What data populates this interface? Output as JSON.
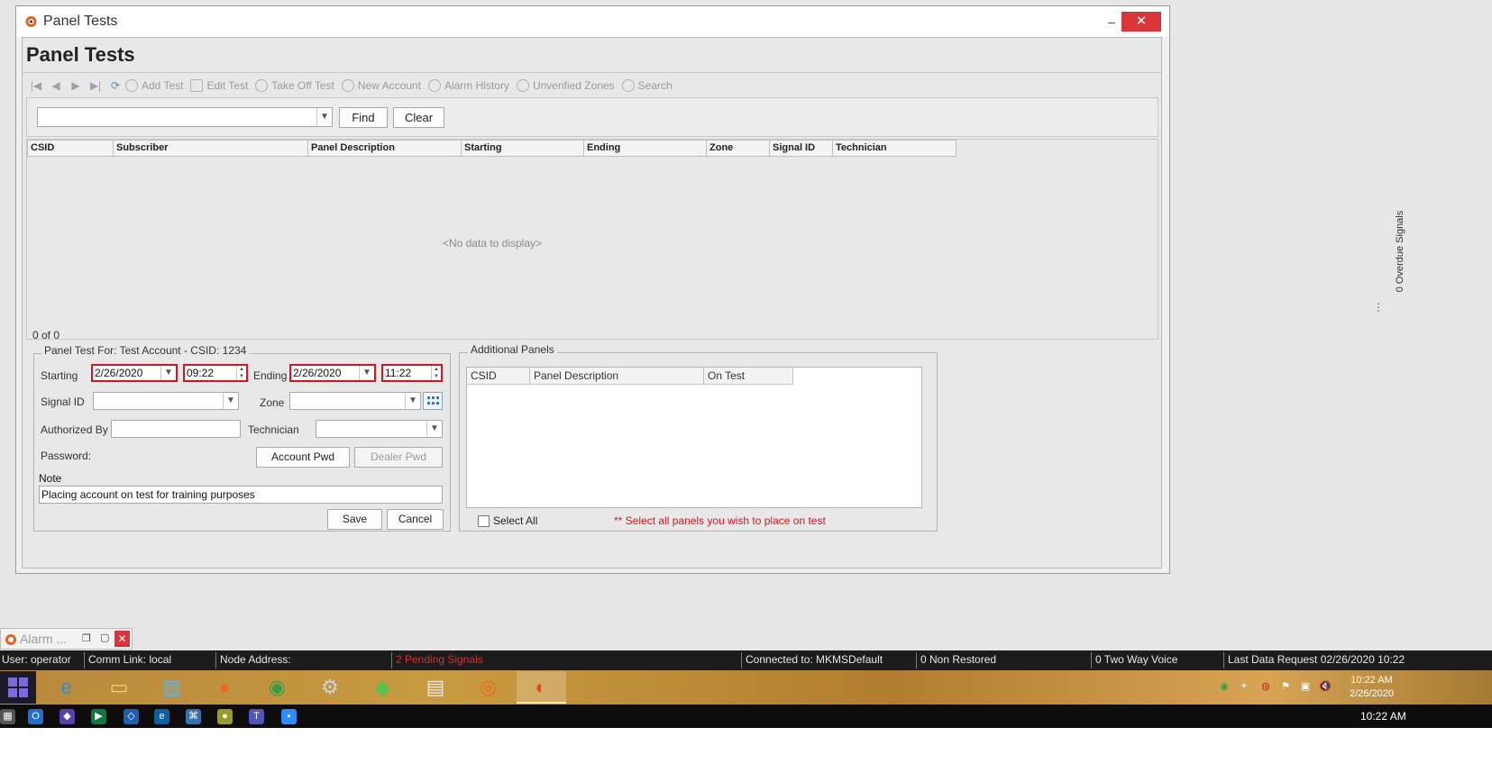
{
  "window": {
    "title": "Panel Tests",
    "minimize": "‒",
    "close": "✕"
  },
  "page": {
    "heading": "Panel Tests"
  },
  "toolbar": {
    "nav": [
      "|◀",
      "◀",
      "▶",
      "▶|"
    ],
    "items": [
      {
        "label": "Add Test",
        "icon": "add-icon"
      },
      {
        "label": "Edit Test",
        "icon": "edit-icon"
      },
      {
        "label": "Take Off Test",
        "icon": "remove-icon"
      },
      {
        "label": "New Account",
        "icon": "users-icon"
      },
      {
        "label": "Alarm History",
        "icon": "history-icon"
      },
      {
        "label": "Unverified Zones",
        "icon": "zones-icon"
      },
      {
        "label": "Search",
        "icon": "search-icon"
      }
    ]
  },
  "search": {
    "value": "",
    "find_label": "Find",
    "clear_label": "Clear"
  },
  "grid": {
    "columns": [
      "CSID",
      "Subscriber",
      "Panel Description",
      "Starting",
      "Ending",
      "Zone",
      "Signal ID",
      "Technician"
    ],
    "empty_text": "<No data to display>",
    "record_count": "0 of 0"
  },
  "panel_test": {
    "legend": "Panel Test For: Test Account - CSID: 1234",
    "starting_label": "Starting",
    "starting_date": "2/26/2020",
    "starting_time": "09:22",
    "ending_label": "Ending",
    "ending_date": "2/26/2020",
    "ending_time": "11:22",
    "signal_id_label": "Signal ID",
    "signal_id_value": "",
    "zone_label": "Zone",
    "zone_value": "",
    "authorized_by_label": "Authorized By",
    "authorized_by_value": "",
    "technician_label": "Technician",
    "technician_value": "",
    "password_label": "Password:",
    "account_pwd_label": "Account Pwd",
    "dealer_pwd_label": "Dealer Pwd",
    "note_label": "Note",
    "note_value": "Placing account on test for training purposes",
    "save_label": "Save",
    "cancel_label": "Cancel"
  },
  "additional_panels": {
    "legend": "Additional Panels",
    "columns": [
      "CSID",
      "Panel Description",
      "On Test"
    ],
    "select_all_label": "Select All",
    "hint": "** Select all panels you wish to place on test"
  },
  "sidebar_right": {
    "overdue_label": "0 Overdue Signals",
    "more": "⋮"
  },
  "mini_alarm": {
    "label": "Alarm ..."
  },
  "status_bar": {
    "user": "User: operator",
    "comm_link": "Comm Link: local",
    "node_address": "Node Address:",
    "pending_signals": "2 Pending Signals",
    "connected": "Connected to: MKMSDefault",
    "non_restored": "0 Non Restored",
    "two_way_voice": "0 Two Way Voice",
    "last_data_request": "Last Data Request 02/26/2020 10:22"
  },
  "taskbar": {
    "apps": [
      {
        "icon": "internet-explorer-icon",
        "glyph": "e",
        "color": "#2a8ee0"
      },
      {
        "icon": "file-explorer-icon",
        "glyph": "▭",
        "color": "#f4d173"
      },
      {
        "icon": "city-app-icon",
        "glyph": "▥",
        "color": "#5fb6e8"
      },
      {
        "icon": "firefox-icon",
        "glyph": "●",
        "color": "#e66b1f"
      },
      {
        "icon": "chrome-icon",
        "glyph": "◉",
        "color": "#3a9b45"
      },
      {
        "icon": "settings-gear-icon",
        "glyph": "⚙",
        "color": "#c8d6e6"
      },
      {
        "icon": "green-gem-icon",
        "glyph": "◆",
        "color": "#57c24d"
      },
      {
        "icon": "archive-icon",
        "glyph": "▤",
        "color": "#e8e8e8"
      },
      {
        "icon": "orange-circle-icon",
        "glyph": "◎",
        "color": "#ef6b1c"
      },
      {
        "icon": "alarm-monitor-icon",
        "glyph": "◐",
        "color": "#e24b1c"
      }
    ],
    "clock_time": "10:22 AM",
    "clock_date": "2/26/2020"
  },
  "bottom_bar": {
    "time": "10:22 AM"
  },
  "colors": {
    "highlight_red": "#e0101a",
    "status_bar_bg": "#1c1c1c",
    "close_red": "#d9353a"
  }
}
